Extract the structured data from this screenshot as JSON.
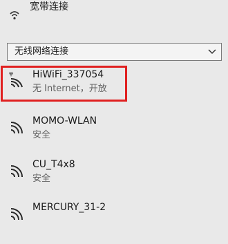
{
  "broadband": {
    "label": "宽带连接",
    "icon": "dialup-connection-icon"
  },
  "dropdown": {
    "label": "无线网络连接",
    "icon": "chevron-down-icon"
  },
  "networks": [
    {
      "name": "HiWiFi_337054",
      "status": "无 Internet，开放",
      "icon": "wifi-warning-icon",
      "highlighted": true
    },
    {
      "name": "MOMO-WLAN",
      "status": "安全",
      "icon": "wifi-signal-icon"
    },
    {
      "name": "CU_T4x8",
      "status": "安全",
      "icon": "wifi-signal-icon"
    },
    {
      "name": "MERCURY_31-2",
      "status": "",
      "icon": "wifi-signal-icon"
    }
  ],
  "colors": {
    "background": "#e9e9e9",
    "highlight": "#e02020",
    "secondary_text": "#606060"
  }
}
